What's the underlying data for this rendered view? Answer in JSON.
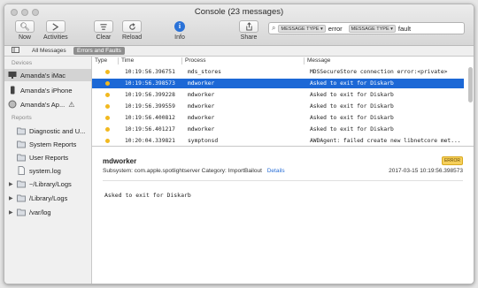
{
  "window": {
    "title": "Console (23 messages)"
  },
  "toolbar": {
    "now": "Now",
    "activities": "Activities",
    "clear": "Clear",
    "reload": "Reload",
    "info": "Info",
    "share": "Share"
  },
  "search": {
    "tokens": [
      {
        "type": "MESSAGE TYPE ▾",
        "value": "error"
      },
      {
        "type": "MESSAGE TYPE ▾",
        "value": "fault"
      }
    ]
  },
  "filterbar": {
    "all": "All Messages",
    "errors": "Errors and Faults"
  },
  "sidebar": {
    "devices_header": "Devices",
    "devices": [
      "Amanda's iMac",
      "Amanda's iPhone",
      "Amanda's Ap..."
    ],
    "reports_header": "Reports",
    "reports": [
      "Diagnostic and U...",
      "System Reports",
      "User Reports",
      "system.log",
      "~/Library/Logs",
      "/Library/Logs",
      "/var/log"
    ]
  },
  "table": {
    "headers": {
      "type": "Type",
      "time": "Time",
      "process": "Process",
      "message": "Message"
    },
    "rows": [
      {
        "time": "10:19:56.396751",
        "process": "mds_stores",
        "message": "MDSSecureStore connection error:<private>"
      },
      {
        "time": "10:19:56.398573",
        "process": "mdworker",
        "message": "Asked to exit for Diskarb"
      },
      {
        "time": "10:19:56.399228",
        "process": "mdworker",
        "message": "Asked to exit for Diskarb"
      },
      {
        "time": "10:19:56.399559",
        "process": "mdworker",
        "message": "Asked to exit for Diskarb"
      },
      {
        "time": "10:19:56.400812",
        "process": "mdworker",
        "message": "Asked to exit for Diskarb"
      },
      {
        "time": "10:19:56.401217",
        "process": "mdworker",
        "message": "Asked to exit for Diskarb"
      },
      {
        "time": "10:20:04.339821",
        "process": "symptonsd",
        "message": "AWDAgent: failed create new libnetcore met..."
      }
    ]
  },
  "detail": {
    "title": "mdworker",
    "badge": "ERROR",
    "subsystem": "Subsystem: com.apple.spotlightserver  Category: ImportBailout",
    "details_link": "Details",
    "timestamp": "2017-03-15 10:19:56.398573",
    "message": "Asked to exit for Diskarb"
  },
  "colors": {
    "selection": "#1c68d6",
    "error_dot": "#f2b91f"
  }
}
